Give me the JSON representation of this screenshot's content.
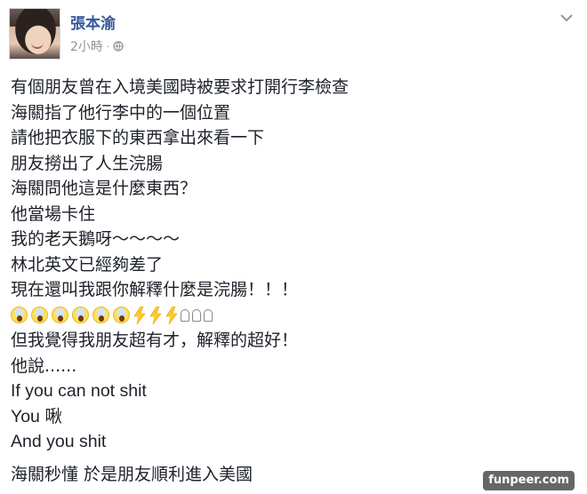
{
  "post": {
    "author": "張本渝",
    "time": "2小時",
    "separator": "·",
    "privacy_icon": "globe-icon",
    "menu_icon": "chevron-down-icon",
    "link_color": "#365899"
  },
  "lines_top": [
    "有個朋友曾在入境美國時被要求打開行李檢查",
    "海關指了他行李中的一個位置",
    "請他把衣服下的東西拿出來看一下",
    "朋友撈出了人生浣腸",
    "海關問他這是什麼東西？",
    "他當場卡住",
    "我的老天鵝呀～～～～",
    "林北英文已經夠差了",
    "現在還叫我跟你解釋什麼是浣腸！！！"
  ],
  "emoji_row": [
    "face-screaming-icon",
    "face-screaming-icon",
    "face-screaming-icon",
    "face-screaming-icon",
    "face-screaming-icon",
    "face-screaming-icon",
    "lightning-icon",
    "lightning-icon",
    "lightning-icon",
    "ghost-icon",
    "ghost-icon",
    "ghost-icon"
  ],
  "lines_mid": [
    "但我覺得我朋友超有才，解釋的超好！",
    "他說......"
  ],
  "lines_latin": [
    "If you can not shit",
    "You 啾",
    "And you shit"
  ],
  "line_end": "海關秒懂 於是朋友順利進入美國",
  "watermark": "funpeer.com"
}
